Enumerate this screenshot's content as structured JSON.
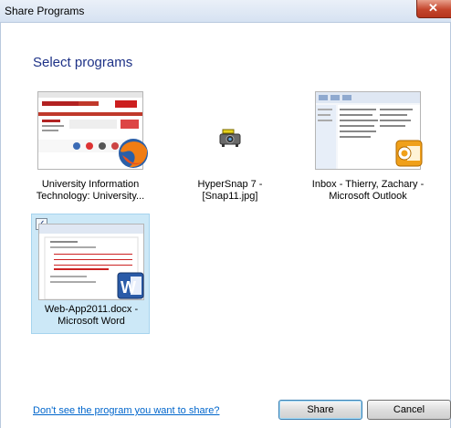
{
  "window": {
    "title": "Share Programs"
  },
  "heading": "Select programs",
  "programs": [
    {
      "label_line1": "University Information",
      "label_line2": "Technology: University...",
      "icon": "firefox-icon",
      "selected": false
    },
    {
      "label_line1": "HyperSnap 7 -",
      "label_line2": "[Snap11.jpg]",
      "icon": "hypersnap-icon",
      "selected": false
    },
    {
      "label_line1": "Inbox - Thierry, Zachary -",
      "label_line2": "Microsoft Outlook",
      "icon": "outlook-icon",
      "selected": false
    },
    {
      "label_line1": "Web-App2011.docx -",
      "label_line2": "Microsoft Word",
      "icon": "word-icon",
      "selected": true
    }
  ],
  "checkbox_mark": "✓",
  "footer": {
    "help_link": "Don't see the program you want to share?",
    "share_label": "Share",
    "cancel_label": "Cancel"
  },
  "colors": {
    "heading": "#1e3287",
    "link": "#0066cc",
    "selected_tile": "#cce8f7",
    "close_button": "#c4452c"
  }
}
